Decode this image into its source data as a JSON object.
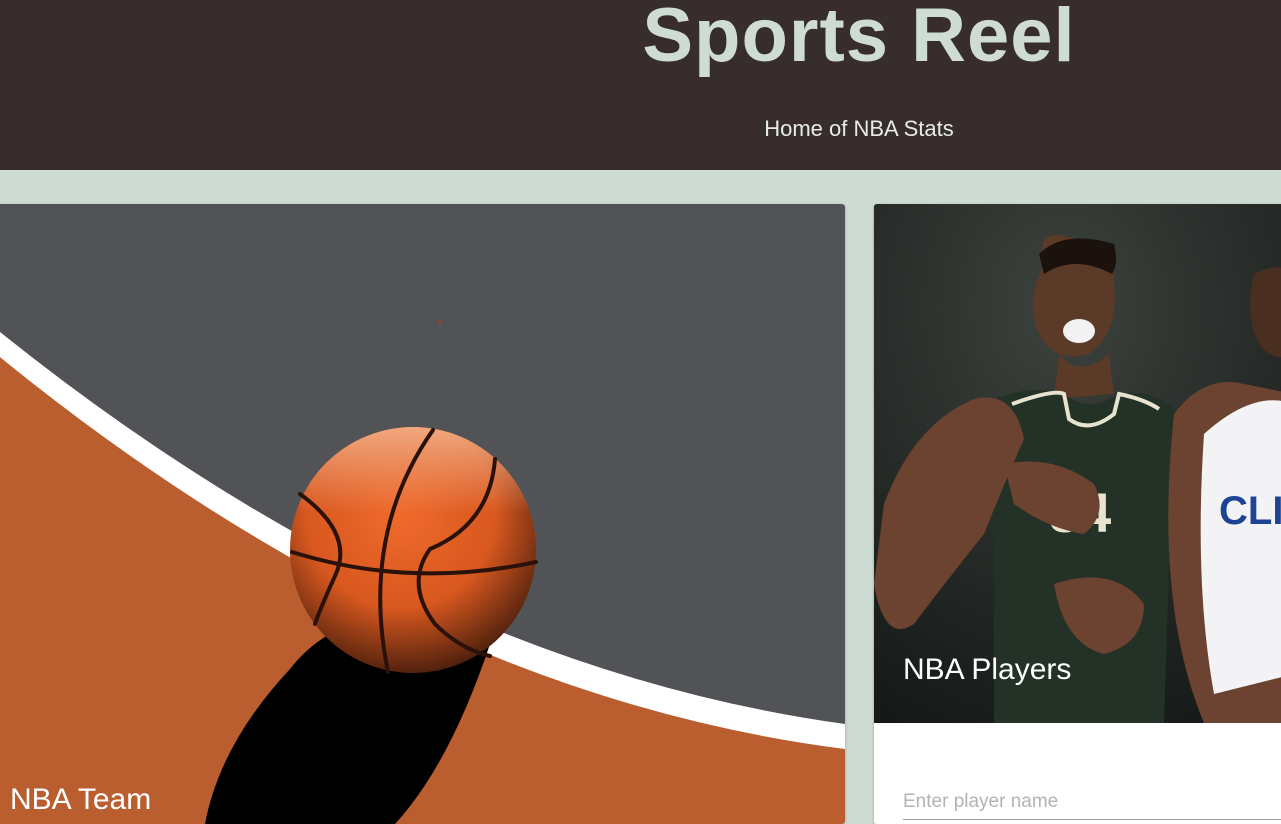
{
  "header": {
    "title": "Sports Reel",
    "subtitle": "Home of NBA Stats",
    "background_color": "#372d2d",
    "title_color": "#cfdcd3"
  },
  "page": {
    "background_color": "#cfdcd3"
  },
  "cards": {
    "team": {
      "title": "NBA Team",
      "image": "basketball-court-illustration"
    },
    "players": {
      "title": "NBA Players",
      "image": "nba-players-photo",
      "input_placeholder": "Enter player name",
      "input_value": ""
    }
  }
}
